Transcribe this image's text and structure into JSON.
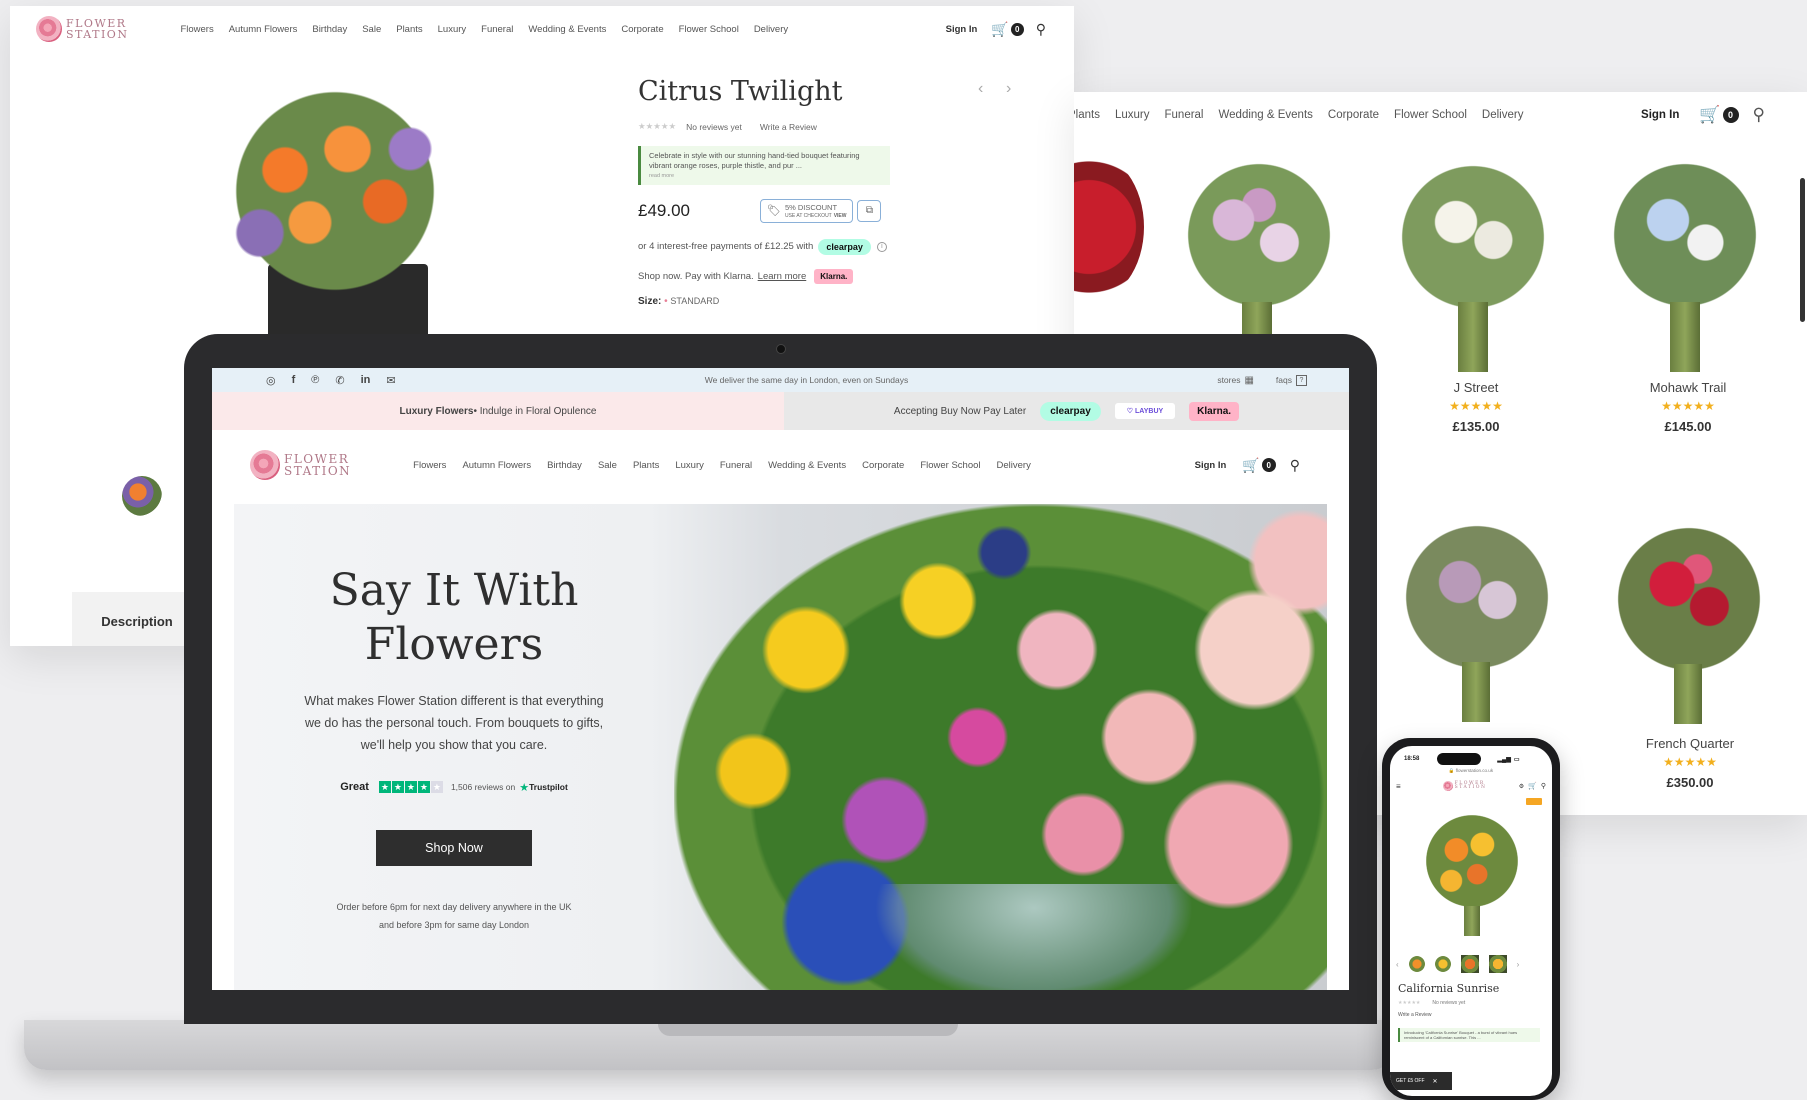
{
  "brand": {
    "line1": "FLOWER",
    "line2": "STATION"
  },
  "nav_items": [
    "Flowers",
    "Autumn Flowers",
    "Birthday",
    "Sale",
    "Plants",
    "Luxury",
    "Funeral",
    "Wedding & Events",
    "Corporate",
    "Flower School",
    "Delivery"
  ],
  "nav_right": {
    "signin": "Sign In",
    "cart_count": "0"
  },
  "product": {
    "title": "Citrus Twilight",
    "no_reviews": "No reviews yet",
    "write_review": "Write a Review",
    "blurb": "Celebrate in style with our stunning hand-tied bouquet featuring vibrant orange roses, purple thistle, and pur ...",
    "read_more": "read more",
    "price": "£49.00",
    "discount_title": "5% DISCOUNT",
    "discount_sub": "USE AT CHECKOUT",
    "discount_view": "VIEW",
    "clearpay_text": "or 4 interest-free payments of £12.25 with",
    "clearpay_logo": "clearpay",
    "info_icon": "i",
    "klarna_text": "Shop now. Pay with Klarna.",
    "klarna_link": "Learn more",
    "klarna_logo": "Klarna.",
    "size_label": "Size:",
    "size_value": "STANDARD",
    "description_tab": "Description"
  },
  "listing": {
    "nav_items": [
      "Plants",
      "Luxury",
      "Funeral",
      "Wedding & Events",
      "Corporate",
      "Flower School",
      "Delivery"
    ],
    "signin": "Sign In",
    "cart_count": "0",
    "products": [
      {
        "name": "J Street",
        "price": "£135.00",
        "stars": "★★★★★"
      },
      {
        "name": "Mohawk Trail",
        "price": "£145.00",
        "stars": "★★★★★"
      },
      {
        "name": "French Quarter",
        "price": "£350.00",
        "stars": "★★★★★"
      }
    ]
  },
  "laptop": {
    "topbar_msg": "We deliver the same day in London, even on Sundays",
    "stores": "stores",
    "faqs": "faqs",
    "promo_left_bold": "Luxury Flowers",
    "promo_left_rest": " • Indulge in Floral Opulence",
    "promo_right": "Accepting Buy Now Pay Later",
    "clearpay": "clearpay",
    "laybuy": "LAYBUY",
    "klarna": "Klarna.",
    "hero_title_1": "Say It With",
    "hero_title_2": "Flowers",
    "hero_text": "What makes Flower Station different is that everything we do has the personal touch. From bouquets to gifts, we'll help you show that you care.",
    "rating_word": "Great",
    "reviews": "1,506 reviews on",
    "trustpilot": "Trustpilot",
    "cta": "Shop Now",
    "delivery_1": "Order before 6pm for next day delivery anywhere in the UK",
    "delivery_2": "and before 3pm for same day London"
  },
  "phone": {
    "time": "18:58",
    "url": "flowerstation.co.uk",
    "product_title": "California Sunrise",
    "no_reviews": "No reviews yet",
    "write_review": "Write a Review",
    "blurb": "Introducing 'California Sunrise' Bouquet - a burst of vibrant hues reminiscent of a Californian sunrise. This ...",
    "promo": "GET £5 OFF",
    "close": "✕"
  },
  "colors": {
    "accent": "#e87f96",
    "clearpay": "#b2fce4",
    "klarna": "#ffb3c7",
    "star": "#f2b01e",
    "trust_green": "#00b67a"
  }
}
